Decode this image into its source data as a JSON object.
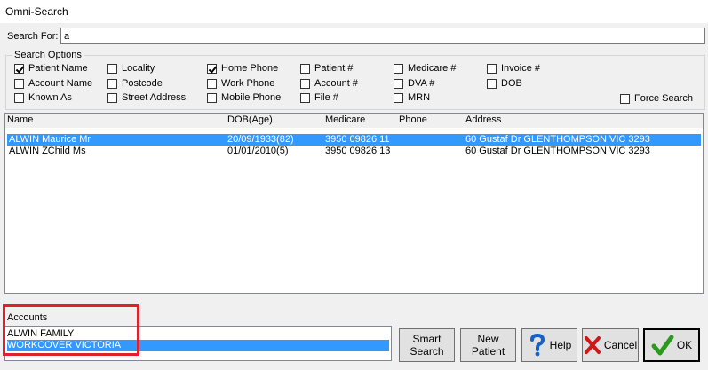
{
  "window": {
    "title": "Omni-Search"
  },
  "search": {
    "label": "Search For:",
    "value": "a"
  },
  "options": {
    "group_title": "Search Options",
    "items": [
      {
        "label": "Patient Name",
        "checked": true
      },
      {
        "label": "Account Name",
        "checked": false
      },
      {
        "label": "Known As",
        "checked": false
      },
      {
        "label": "Locality",
        "checked": false
      },
      {
        "label": "Postcode",
        "checked": false
      },
      {
        "label": "Street Address",
        "checked": false
      },
      {
        "label": "Home Phone",
        "checked": true
      },
      {
        "label": "Work Phone",
        "checked": false
      },
      {
        "label": "Mobile Phone",
        "checked": false
      },
      {
        "label": "Patient #",
        "checked": false
      },
      {
        "label": "Account #",
        "checked": false
      },
      {
        "label": "File #",
        "checked": false
      },
      {
        "label": "Medicare #",
        "checked": false
      },
      {
        "label": "DVA #",
        "checked": false
      },
      {
        "label": "MRN",
        "checked": false
      },
      {
        "label": "Invoice #",
        "checked": false
      },
      {
        "label": "DOB",
        "checked": false
      },
      {
        "label": "Force Search",
        "checked": false
      }
    ]
  },
  "results": {
    "columns": [
      "Name",
      "DOB(Age)",
      "Medicare",
      "Phone",
      "Address"
    ],
    "rows": [
      {
        "name": "ALWIN Maurice Mr",
        "dob": "20/09/1933(82)",
        "medicare": "3950 09826 11",
        "phone": "",
        "address": "60 Gustaf Dr GLENTHOMPSON VIC 3293",
        "selected": true
      },
      {
        "name": "ALWIN ZChild Ms",
        "dob": "01/01/2010(5)",
        "medicare": "3950 09826 13",
        "phone": "",
        "address": "60 Gustaf Dr GLENTHOMPSON VIC 3293",
        "selected": false
      }
    ]
  },
  "accounts": {
    "label": "Accounts",
    "items": [
      {
        "label": "ALWIN FAMILY",
        "selected": false
      },
      {
        "label": "WORKCOVER VICTORIA",
        "selected": true
      }
    ]
  },
  "buttons": {
    "smart_1": "Smart",
    "smart_2": "Search",
    "new_1": "New",
    "new_2": "Patient",
    "help": "Help",
    "cancel": "Cancel",
    "ok": "OK"
  },
  "colors": {
    "selection": "#3399ff",
    "annotation": "#e0202a",
    "ok_check": "#2a9a1c",
    "cancel_x": "#d01818",
    "help_q": "#1a5fc4"
  },
  "icons": {
    "help": "question-mark-icon",
    "cancel": "red-x-icon",
    "ok": "green-check-icon"
  }
}
